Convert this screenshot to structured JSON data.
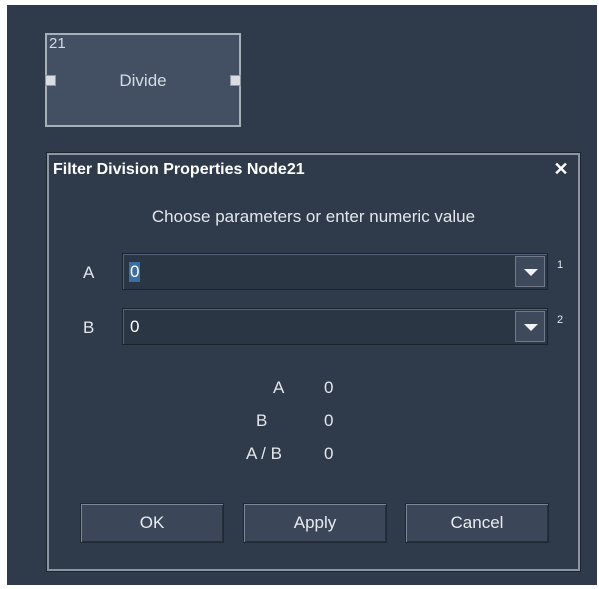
{
  "node": {
    "id": "21",
    "title": "Divide"
  },
  "dialog": {
    "title": "Filter Division Properties Node21",
    "close_glyph": "✕",
    "instruction": "Choose parameters or enter numeric value",
    "params": [
      {
        "label": "A",
        "value": "0",
        "slot": "1",
        "selected": true
      },
      {
        "label": "B",
        "value": "0",
        "slot": "2",
        "selected": false
      }
    ],
    "results": [
      {
        "label": "A",
        "value": "0"
      },
      {
        "label": "B",
        "value": "0"
      },
      {
        "label": "A / B",
        "value": "0"
      }
    ],
    "buttons": {
      "ok": "OK",
      "apply": "Apply",
      "cancel": "Cancel"
    }
  },
  "icons": {
    "combo_arrow": "chevron-down-icon",
    "close": "close-icon"
  }
}
